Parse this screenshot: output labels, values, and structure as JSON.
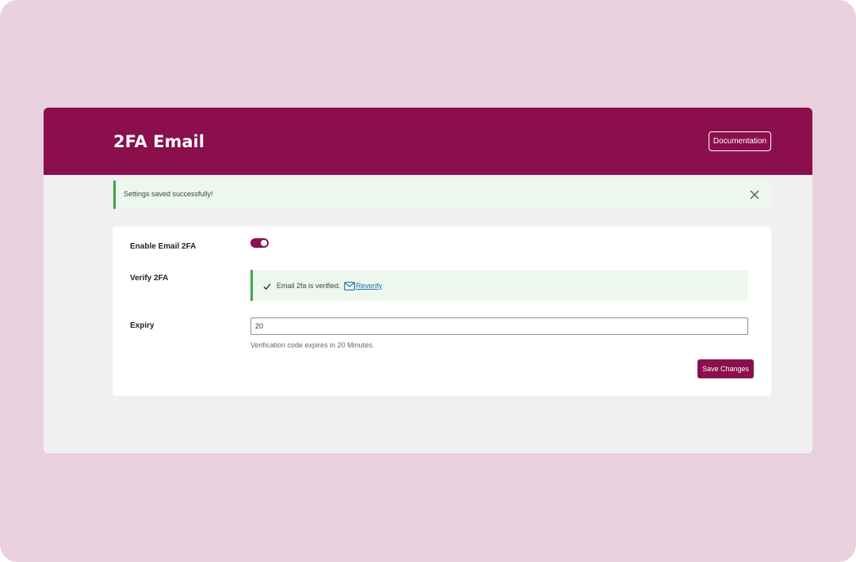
{
  "header": {
    "title": "2FA Email",
    "documentation_label": "Documentation"
  },
  "notice": {
    "message": "Settings saved successfully!",
    "close_icon": "close-icon"
  },
  "form": {
    "enable": {
      "label": "Enable Email 2FA",
      "checked": true
    },
    "verify": {
      "label": "Verify 2FA",
      "status_text": "Email 2fa is verified.",
      "reverify_label": "Reverify",
      "check_icon": "check-icon",
      "mail_icon": "mail-icon"
    },
    "expiry": {
      "label": "Expiry",
      "value": "20",
      "help": "Verification code expires in 20 Minutes."
    },
    "save_label": "Save Changes"
  },
  "colors": {
    "brand": "#8a0f4c",
    "success": "#3fa648",
    "backdrop": "#e8d0dc",
    "link": "#2271b1"
  }
}
